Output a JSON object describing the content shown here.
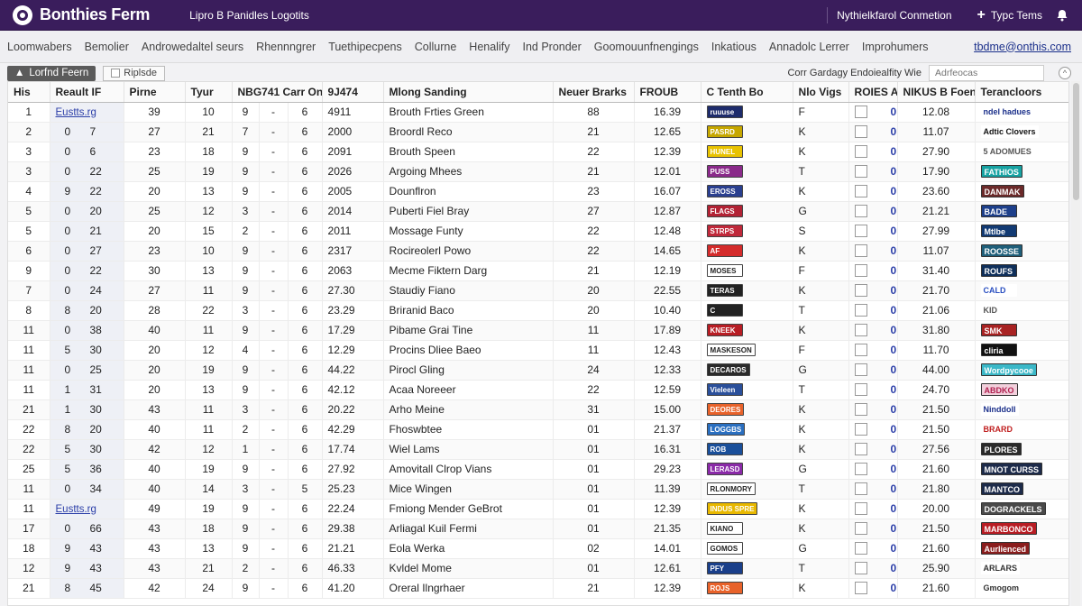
{
  "topbar": {
    "title": "Bonthies Ferm",
    "subtitle": "Lipro B Panidles Logotits",
    "connection": "Nythielkfarol Conmetion",
    "type_button": "Typc Tems"
  },
  "menu": [
    "Loomwabers",
    "Bemolier",
    "Androwedaltel seurs",
    "Rhennngrer",
    "Tuethipecpens",
    "Collurne",
    "Henalify",
    "Ind Pronder",
    "Goomouunfnengings",
    "Inkatious",
    "Annadolc Lerrer",
    "Improhumers"
  ],
  "menu_link": "tbdme@onthis.com",
  "toolbar": {
    "chip_active": "Lorfnd Feern",
    "chip_secondary": "Riplsde",
    "filter_label": "Corr Gardagy Endoiealfity Wie",
    "filter_placeholder": "Adrfeocas"
  },
  "columns": [
    "His",
    "Reault IF",
    "Pirne",
    "Tyur",
    "NBG741 Carr On",
    "9J474",
    "Mlong Sanding",
    "Neuer Brarks",
    "FROUB",
    "C Tenth Bo",
    "Nlo Vigs",
    "ROIES A",
    "NIKUS B Foen",
    "Terancloors"
  ],
  "rows": [
    {
      "his": "1",
      "rec_a": "Eustts.rg",
      "rec_b": "",
      "pirne": "39",
      "tyur": "10",
      "c1": "9",
      "c2": "-",
      "c3": "6",
      "yr": "4911",
      "name": "Brouth Frties Green",
      "nb": "88",
      "fr": "16.39",
      "tb": "ruuuse",
      "tbc": "#1d2b6b",
      "nv": "F",
      "roi": "0",
      "nk": "12.08",
      "ter": "ndel hadues",
      "terc": "#ffffff",
      "tert": "#1a2f8a",
      "link": true
    },
    {
      "his": "2",
      "rec_a": "0",
      "rec_b": "7",
      "pirne": "27",
      "tyur": "21",
      "c1": "7",
      "c2": "-",
      "c3": "6",
      "yr": "2000",
      "name": "Broordl Reco",
      "nb": "21",
      "fr": "12.65",
      "tb": "PASRD",
      "tbc": "#c6a700",
      "nv": "K",
      "roi": "0",
      "nk": "11.07",
      "ter": "Adtic Clovers",
      "terc": "#ffffff",
      "tert": "#111111"
    },
    {
      "his": "3",
      "rec_a": "0",
      "rec_b": "6",
      "pirne": "23",
      "tyur": "18",
      "c1": "9",
      "c2": "-",
      "c3": "6",
      "yr": "2091",
      "name": "Brouth Speen",
      "nb": "22",
      "fr": "12.39",
      "tb": "HUNEL",
      "tbc": "#e8c200",
      "nv": "K",
      "roi": "0",
      "nk": "27.90",
      "ter": "5 ADOMUES",
      "terc": "#ffffff",
      "tert": "#555555"
    },
    {
      "his": "3",
      "rec_a": "0",
      "rec_b": "22",
      "pirne": "25",
      "tyur": "19",
      "c1": "9",
      "c2": "-",
      "c3": "6",
      "yr": "2026",
      "name": "Argoing Mhees",
      "nb": "21",
      "fr": "12.01",
      "tb": "PUSS",
      "tbc": "#8a2a8a",
      "nv": "T",
      "roi": "0",
      "nk": "17.90",
      "ter": "FATHIOS",
      "terc": "#17a2a2",
      "tert": "#ffffff"
    },
    {
      "his": "4",
      "rec_a": "9",
      "rec_b": "22",
      "pirne": "20",
      "tyur": "13",
      "c1": "9",
      "c2": "-",
      "c3": "6",
      "yr": "2005",
      "name": "Dounflron",
      "nb": "23",
      "fr": "16.07",
      "tb": "EROSS",
      "tbc": "#2a3f8f",
      "nv": "K",
      "roi": "0",
      "nk": "23.60",
      "ter": "DANMAK",
      "terc": "#6b2a2a",
      "tert": "#ffffff"
    },
    {
      "his": "5",
      "rec_a": "0",
      "rec_b": "20",
      "pirne": "25",
      "tyur": "12",
      "c1": "3",
      "c2": "-",
      "c3": "6",
      "yr": "2014",
      "name": "Puberti Fiel Bray",
      "nb": "27",
      "fr": "12.87",
      "tb": "FLAGS",
      "tbc": "#b22234",
      "nv": "G",
      "roi": "0",
      "nk": "21.21",
      "ter": "BADE",
      "terc": "#1d3f8a",
      "tert": "#ffffff"
    },
    {
      "his": "5",
      "rec_a": "0",
      "rec_b": "21",
      "pirne": "20",
      "tyur": "15",
      "c1": "2",
      "c2": "-",
      "c3": "6",
      "yr": "2011",
      "name": "Mossage Funty",
      "nb": "22",
      "fr": "12.48",
      "tb": "STRPS",
      "tbc": "#c0283a",
      "nv": "S",
      "roi": "0",
      "nk": "27.99",
      "ter": "Mtlbe",
      "terc": "#123a73",
      "tert": "#ffffff"
    },
    {
      "his": "6",
      "rec_a": "0",
      "rec_b": "27",
      "pirne": "23",
      "tyur": "10",
      "c1": "9",
      "c2": "-",
      "c3": "6",
      "yr": "2317",
      "name": "Rocireolerl Powo",
      "nb": "22",
      "fr": "14.65",
      "tb": "AF",
      "tbc": "#d42b2b",
      "nv": "K",
      "roi": "0",
      "nk": "11.07",
      "ter": "ROOSSE",
      "terc": "#1f5f7a",
      "tert": "#ffffff"
    },
    {
      "his": "9",
      "rec_a": "0",
      "rec_b": "22",
      "pirne": "30",
      "tyur": "13",
      "c1": "9",
      "c2": "-",
      "c3": "6",
      "yr": "2063",
      "name": "Mecme Fiktern Darg",
      "nb": "21",
      "fr": "12.19",
      "tb": "MOSES",
      "tbc": "#ffffff",
      "nv": "F",
      "roi": "0",
      "nk": "31.40",
      "ter": "ROUFS",
      "terc": "#0f2f5a",
      "tert": "#ffffff"
    },
    {
      "his": "7",
      "rec_a": "0",
      "rec_b": "24",
      "pirne": "27",
      "tyur": "11",
      "c1": "9",
      "c2": "-",
      "c3": "6",
      "yr": "27.30",
      "name": "Staudiy Fiano",
      "nb": "20",
      "fr": "22.55",
      "tb": "TERAS",
      "tbc": "#222222",
      "nv": "K",
      "roi": "0",
      "nk": "21.70",
      "ter": "CALD",
      "terc": "#ffffff",
      "tert": "#2a4fc0"
    },
    {
      "his": "8",
      "rec_a": "8",
      "rec_b": "20",
      "pirne": "28",
      "tyur": "22",
      "c1": "3",
      "c2": "-",
      "c3": "6",
      "yr": "23.29",
      "name": "Briranid Baco",
      "nb": "20",
      "fr": "10.40",
      "tb": "C",
      "tbc": "#222222",
      "nv": "T",
      "roi": "0",
      "nk": "21.06",
      "ter": "KID",
      "terc": "#ffffff",
      "tert": "#555555"
    },
    {
      "his": "11",
      "rec_a": "0",
      "rec_b": "38",
      "pirne": "40",
      "tyur": "11",
      "c1": "9",
      "c2": "-",
      "c3": "6",
      "yr": "17.29",
      "name": "Pibame Grai Tine",
      "nb": "11",
      "fr": "17.89",
      "tb": "KNEEK",
      "tbc": "#b81d24",
      "nv": "K",
      "roi": "0",
      "nk": "31.80",
      "ter": "SMK",
      "terc": "#a82222",
      "tert": "#ffffff"
    },
    {
      "his": "11",
      "rec_a": "5",
      "rec_b": "30",
      "pirne": "20",
      "tyur": "12",
      "c1": "4",
      "c2": "-",
      "c3": "6",
      "yr": "12.29",
      "name": "Procins Dliee Baeo",
      "nb": "11",
      "fr": "12.43",
      "tb": "MASKESON",
      "tbc": "#ffffff",
      "nv": "F",
      "roi": "0",
      "nk": "11.70",
      "ter": "cliria",
      "terc": "#111111",
      "tert": "#ffffff"
    },
    {
      "his": "11",
      "rec_a": "0",
      "rec_b": "25",
      "pirne": "20",
      "tyur": "19",
      "c1": "9",
      "c2": "-",
      "c3": "6",
      "yr": "44.22",
      "name": "Pirocl Gling",
      "nb": "24",
      "fr": "12.33",
      "tb": "DECAROS",
      "tbc": "#2a2a2a",
      "nv": "G",
      "roi": "0",
      "nk": "44.00",
      "ter": "Wordpycooe",
      "terc": "#3bb8c8",
      "tert": "#ffffff"
    },
    {
      "his": "11",
      "rec_a": "1",
      "rec_b": "31",
      "pirne": "20",
      "tyur": "13",
      "c1": "9",
      "c2": "-",
      "c3": "6",
      "yr": "42.12",
      "name": "Acaa Noreeer",
      "nb": "22",
      "fr": "12.59",
      "tb": "Vieleen",
      "tbc": "#2a4f9a",
      "nv": "T",
      "roi": "0",
      "nk": "24.70",
      "ter": "ABDKO",
      "terc": "#f2d0dc",
      "tert": "#b02050"
    },
    {
      "his": "21",
      "rec_a": "1",
      "rec_b": "30",
      "pirne": "43",
      "tyur": "11",
      "c1": "3",
      "c2": "-",
      "c3": "6",
      "yr": "20.22",
      "name": "Arho Meine",
      "nb": "31",
      "fr": "15.00",
      "tb": "DEORES",
      "tbc": "#e8622a",
      "nv": "K",
      "roi": "0",
      "nk": "21.50",
      "ter": "Ninddoll",
      "terc": "#ffffff",
      "tert": "#1a2f8a"
    },
    {
      "his": "22",
      "rec_a": "8",
      "rec_b": "20",
      "pirne": "40",
      "tyur": "11",
      "c1": "2",
      "c2": "-",
      "c3": "6",
      "yr": "42.29",
      "name": "Fhoswbtee",
      "nb": "01",
      "fr": "21.37",
      "tb": "LOGGBS",
      "tbc": "#2a6fc0",
      "nv": "K",
      "roi": "0",
      "nk": "21.50",
      "ter": "BRARD",
      "terc": "#ffffff",
      "tert": "#c02020"
    },
    {
      "his": "22",
      "rec_a": "5",
      "rec_b": "30",
      "pirne": "42",
      "tyur": "12",
      "c1": "1",
      "c2": "-",
      "c3": "6",
      "yr": "17.74",
      "name": "Wiel Lams",
      "nb": "01",
      "fr": "16.31",
      "tb": "ROB",
      "tbc": "#1a4f9a",
      "nv": "K",
      "roi": "0",
      "nk": "27.56",
      "ter": "PLORES",
      "terc": "#2a2a2a",
      "tert": "#ffffff"
    },
    {
      "his": "25",
      "rec_a": "5",
      "rec_b": "36",
      "pirne": "40",
      "tyur": "19",
      "c1": "9",
      "c2": "-",
      "c3": "6",
      "yr": "27.92",
      "name": "Amovitall Clrop Vians",
      "nb": "01",
      "fr": "29.23",
      "tb": "LERASD",
      "tbc": "#8a2aa8",
      "nv": "G",
      "roi": "0",
      "nk": "21.60",
      "ter": "MNOT CURSS",
      "terc": "#1d2b4a",
      "tert": "#ffffff"
    },
    {
      "his": "11",
      "rec_a": "0",
      "rec_b": "34",
      "pirne": "40",
      "tyur": "14",
      "c1": "3",
      "c2": "-",
      "c3": "5",
      "yr": "25.23",
      "name": "Mice Wingen",
      "nb": "01",
      "fr": "11.39",
      "tb": "RLONMORY",
      "tbc": "#ffffff",
      "nv": "T",
      "roi": "0",
      "nk": "21.80",
      "ter": "MANTCO",
      "terc": "#1d2b4a",
      "tert": "#ffffff"
    },
    {
      "his": "11",
      "rec_a": "Eustts.rg",
      "rec_b": "",
      "pirne": "49",
      "tyur": "19",
      "c1": "9",
      "c2": "-",
      "c3": "6",
      "yr": "22.24",
      "name": "Fmiong Mender GeBrot",
      "nb": "01",
      "fr": "12.39",
      "tb": "INDUS SPRE",
      "tbc": "#e8b800",
      "nv": "K",
      "roi": "0",
      "nk": "20.00",
      "ter": "DOGRACKELS",
      "terc": "#4a4a4a",
      "tert": "#ffffff",
      "link": true
    },
    {
      "his": "17",
      "rec_a": "0",
      "rec_b": "66",
      "pirne": "43",
      "tyur": "18",
      "c1": "9",
      "c2": "-",
      "c3": "6",
      "yr": "29.38",
      "name": "Arliagal Kuil Fermi",
      "nb": "01",
      "fr": "21.35",
      "tb": "KIANO",
      "tbc": "#ffffff",
      "nv": "K",
      "roi": "0",
      "nk": "21.50",
      "ter": "MARBONCO",
      "terc": "#b81d24",
      "tert": "#ffffff"
    },
    {
      "his": "18",
      "rec_a": "9",
      "rec_b": "43",
      "pirne": "43",
      "tyur": "13",
      "c1": "9",
      "c2": "-",
      "c3": "6",
      "yr": "21.21",
      "name": "Eola Werka",
      "nb": "02",
      "fr": "14.01",
      "tb": "GOMOS",
      "tbc": "#ffffff",
      "nv": "G",
      "roi": "0",
      "nk": "21.60",
      "ter": "Aurlienced",
      "terc": "#8a1d1d",
      "tert": "#ffffff"
    },
    {
      "his": "12",
      "rec_a": "9",
      "rec_b": "43",
      "pirne": "43",
      "tyur": "21",
      "c1": "2",
      "c2": "-",
      "c3": "6",
      "yr": "46.33",
      "name": "Kvldel Mome",
      "nb": "01",
      "fr": "12.61",
      "tb": "PFY",
      "tbc": "#1a3f8a",
      "nv": "T",
      "roi": "0",
      "nk": "25.90",
      "ter": "ARLARS",
      "terc": "#ffffff",
      "tert": "#333333"
    },
    {
      "his": "21",
      "rec_a": "8",
      "rec_b": "45",
      "pirne": "42",
      "tyur": "24",
      "c1": "9",
      "c2": "-",
      "c3": "6",
      "yr": "41.20",
      "name": "Oreral Ilngrhaer",
      "nb": "21",
      "fr": "12.39",
      "tb": "ROJS",
      "tbc": "#e8622a",
      "nv": "K",
      "roi": "0",
      "nk": "21.60",
      "ter": "Gmogom",
      "terc": "#ffffff",
      "tert": "#333333"
    }
  ]
}
